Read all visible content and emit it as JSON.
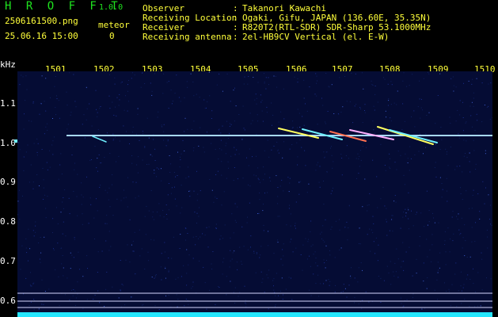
{
  "header": {
    "app_name": "H R O F F T",
    "app_version": "1.0.0",
    "filename": "2506161500.png",
    "datetime": "25.06.16 15:00",
    "meteor_label": "meteor",
    "meteor_count": "0",
    "info": [
      {
        "label": "Observer",
        "value": "Takanori Kawachi"
      },
      {
        "label": "Receiving Location",
        "value": "Ogaki, Gifu, JAPAN (136.60E, 35.35N)"
      },
      {
        "label": "Receiver",
        "value": "R820T2(RTL-SDR) SDR-Sharp 53.1000MHz"
      },
      {
        "label": "Receiving antenna",
        "value": "2el-HB9CV Vertical (el. E-W)"
      }
    ]
  },
  "axis": {
    "y_unit": "kHz",
    "x_ticks": [
      "1501",
      "1502",
      "1503",
      "1504",
      "1505",
      "1506",
      "1507",
      "1508",
      "1509",
      "1510"
    ],
    "y_ticks": [
      "1.1",
      "1.0",
      "0.9",
      "0.8",
      "0.7",
      "0.6"
    ]
  },
  "colors": {
    "header_text": "#ffff3a",
    "title_green": "#1fe41f",
    "background": "#050c34",
    "signal": "#9ad8ff",
    "noise_floor": "#25e6ff"
  }
}
